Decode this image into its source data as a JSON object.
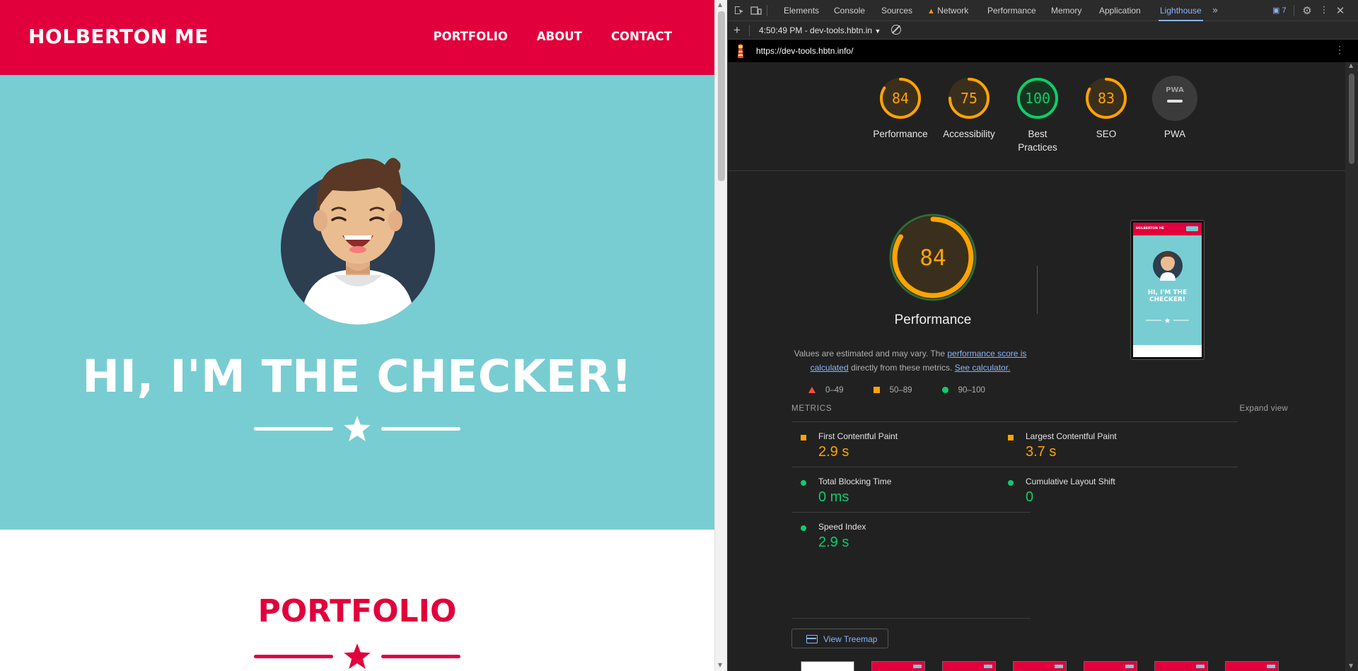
{
  "site": {
    "brand": "HOLBERTON ME",
    "nav": [
      "PORTFOLIO",
      "ABOUT",
      "CONTACT"
    ],
    "hero_title": "HI, I'M THE CHECKER!",
    "section_title": "PORTFOLIO",
    "colors": {
      "primary": "#e1003c",
      "hero_bg": "#78cdd2"
    }
  },
  "devtools": {
    "tabs": [
      "Elements",
      "Console",
      "Sources",
      "Network",
      "Performance",
      "Memory",
      "Application",
      "Lighthouse"
    ],
    "active_tab": "Lighthouse",
    "warning_tab": "Network",
    "issues_count": "7",
    "report_selector": "4:50:49 PM - dev-tools.hbtn.in",
    "icons": [
      "inspect-element-icon",
      "device-toolbar-icon",
      "more-tabs-icon",
      "issues-icon",
      "settings-gear-icon",
      "kebab-menu-icon",
      "close-icon",
      "add-report-icon",
      "clear-icon"
    ]
  },
  "lighthouse": {
    "url": "https://dev-tools.hbtn.info/",
    "categories": [
      {
        "label": "Performance",
        "score": "84",
        "fraction": 0.84,
        "color": "#ffa400"
      },
      {
        "label": "Accessibility",
        "score": "75",
        "fraction": 0.75,
        "color": "#ffa400"
      },
      {
        "label": "Best Practices",
        "score": "100",
        "fraction": 1.0,
        "color": "#0cce6b"
      },
      {
        "label": "SEO",
        "score": "83",
        "fraction": 0.83,
        "color": "#ffa400"
      },
      {
        "label": "PWA",
        "score": "PWA",
        "fraction": 0,
        "color": "#9e9e9e"
      }
    ],
    "perf_score": "84",
    "perf_fraction": 0.84,
    "perf_title": "Performance",
    "desc_prefix": "Values are estimated and may vary. The",
    "desc_link": "performance score is calculated",
    "desc_middle": "directly from these metrics.",
    "desc_link2": "See calculator.",
    "legend": [
      "0–49",
      "50–89",
      "90–100"
    ],
    "metrics_heading": "METRICS",
    "expand_view": "Expand view",
    "metrics": [
      {
        "name": "First Contentful Paint",
        "value": "2.9 s",
        "status": "average"
      },
      {
        "name": "Largest Contentful Paint",
        "value": "3.7 s",
        "status": "average"
      },
      {
        "name": "Total Blocking Time",
        "value": "0 ms",
        "status": "pass"
      },
      {
        "name": "Cumulative Layout Shift",
        "value": "0",
        "status": "pass"
      },
      {
        "name": "Speed Index",
        "value": "2.9 s",
        "status": "pass"
      }
    ],
    "status_colors": {
      "fail": "#ff4e42",
      "average": "#ffa400",
      "pass": "#0cce6b"
    },
    "view_treemap": "View Treemap",
    "screenshot": {
      "brand": "HOLBERTON ME",
      "title": "HI, I'M THE CHECKER!"
    },
    "filmstrip_frames": 7
  }
}
